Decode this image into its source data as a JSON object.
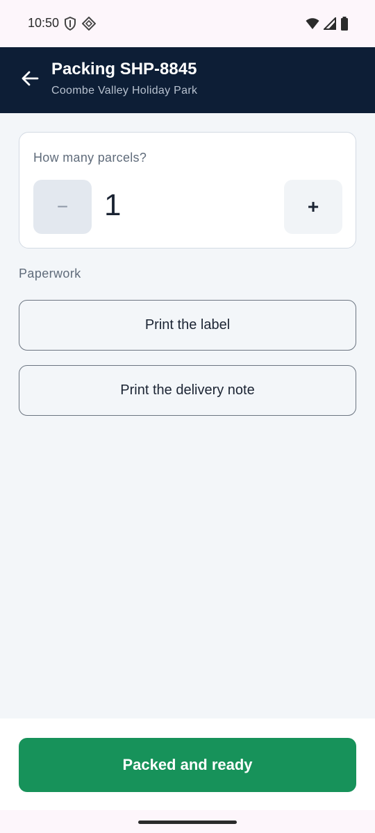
{
  "status_bar": {
    "time": "10:50",
    "icons": [
      "shield-icon",
      "network-icon",
      "wifi-icon",
      "signal-icon",
      "battery-icon"
    ]
  },
  "app_bar": {
    "title": "Packing SHP-8845",
    "subtitle": "Coombe Valley Holiday Park",
    "back_icon": "arrow-left-icon"
  },
  "parcels": {
    "question": "How many parcels?",
    "minus_label": "−",
    "value": "1",
    "plus_label": "+"
  },
  "paperwork": {
    "section_label": "Paperwork",
    "print_label": "Print the label",
    "print_delivery_note": "Print the delivery note"
  },
  "footer": {
    "primary_action": "Packed and ready"
  },
  "colors": {
    "app_bar": "#0d1e36",
    "primary": "#17925a",
    "background": "#f3f6f9"
  }
}
